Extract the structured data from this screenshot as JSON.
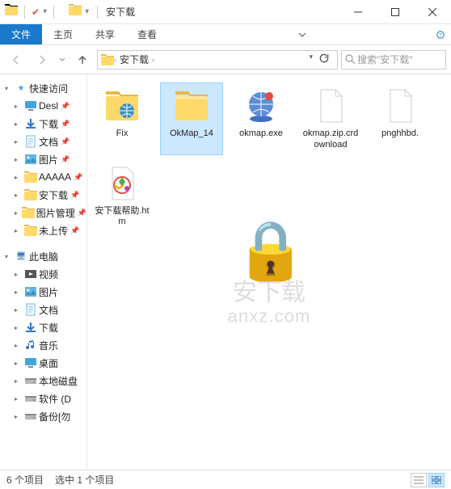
{
  "window": {
    "title": "安下载"
  },
  "ribbon": {
    "tabs": {
      "file": "文件",
      "home": "主页",
      "share": "共享",
      "view": "查看"
    }
  },
  "nav": {
    "crumb": "安下载",
    "search_placeholder": "搜索\"安下载\""
  },
  "sidebar": {
    "quick_access": "快速访问",
    "quick_items": [
      {
        "label": "Desl",
        "icon": "desktop"
      },
      {
        "label": "下载",
        "icon": "downloads"
      },
      {
        "label": "文档",
        "icon": "docs"
      },
      {
        "label": "图片",
        "icon": "pics"
      },
      {
        "label": "AAAAA",
        "icon": "folder"
      },
      {
        "label": "安下载",
        "icon": "folder"
      },
      {
        "label": "图片管理",
        "icon": "folder"
      },
      {
        "label": "未上传",
        "icon": "folder"
      }
    ],
    "this_pc": "此电脑",
    "pc_items": [
      {
        "label": "视频",
        "icon": "video"
      },
      {
        "label": "图片",
        "icon": "pics"
      },
      {
        "label": "文档",
        "icon": "docs"
      },
      {
        "label": "下载",
        "icon": "downloads"
      },
      {
        "label": "音乐",
        "icon": "music"
      },
      {
        "label": "桌面",
        "icon": "desktop"
      },
      {
        "label": "本地磁盘",
        "icon": "disk"
      },
      {
        "label": "软件 (D",
        "icon": "disk"
      },
      {
        "label": "备份[勿",
        "icon": "disk"
      }
    ]
  },
  "files": [
    {
      "label": "Fix",
      "type": "folder-globe"
    },
    {
      "label": "OkMap_14",
      "type": "folder",
      "selected": true
    },
    {
      "label": "okmap.exe",
      "type": "exe-globe"
    },
    {
      "label": "okmap.zip.crdownload",
      "type": "file-blank"
    },
    {
      "label": "pnghhbd.",
      "type": "file-blank"
    },
    {
      "label": "安下载帮助.htm",
      "type": "htm-color"
    }
  ],
  "watermark": {
    "line1": "安下载",
    "line2": "anxz.com"
  },
  "status": {
    "count": "6 个项目",
    "selected": "选中 1 个项目"
  }
}
